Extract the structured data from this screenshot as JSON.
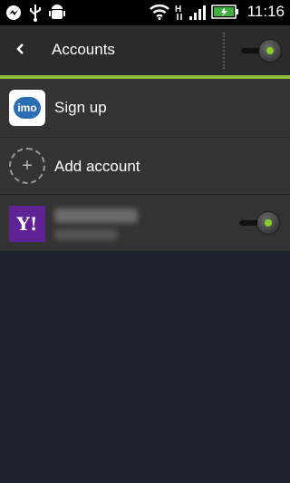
{
  "status_bar": {
    "time": "11:16",
    "icons": [
      "messenger-icon",
      "usb-icon",
      "android-debug-icon",
      "wifi-icon",
      "h-data-icon",
      "signal-icon",
      "battery-charging-icon"
    ]
  },
  "header": {
    "title": "Accounts",
    "accounts_enabled": true
  },
  "accounts": [
    {
      "label": "Sign up",
      "icon": "imo-icon",
      "icon_text": "imo"
    },
    {
      "label": "Add account",
      "icon": "add-icon",
      "icon_text": "+"
    },
    {
      "label": "",
      "icon": "yahoo-icon",
      "icon_text": "Y!",
      "enabled": true
    }
  ],
  "colors": {
    "accent": "#8bc23a",
    "background": "#1c2230",
    "list_bg": "#333333",
    "yahoo": "#5f2294",
    "imo": "#2a6fb3"
  }
}
